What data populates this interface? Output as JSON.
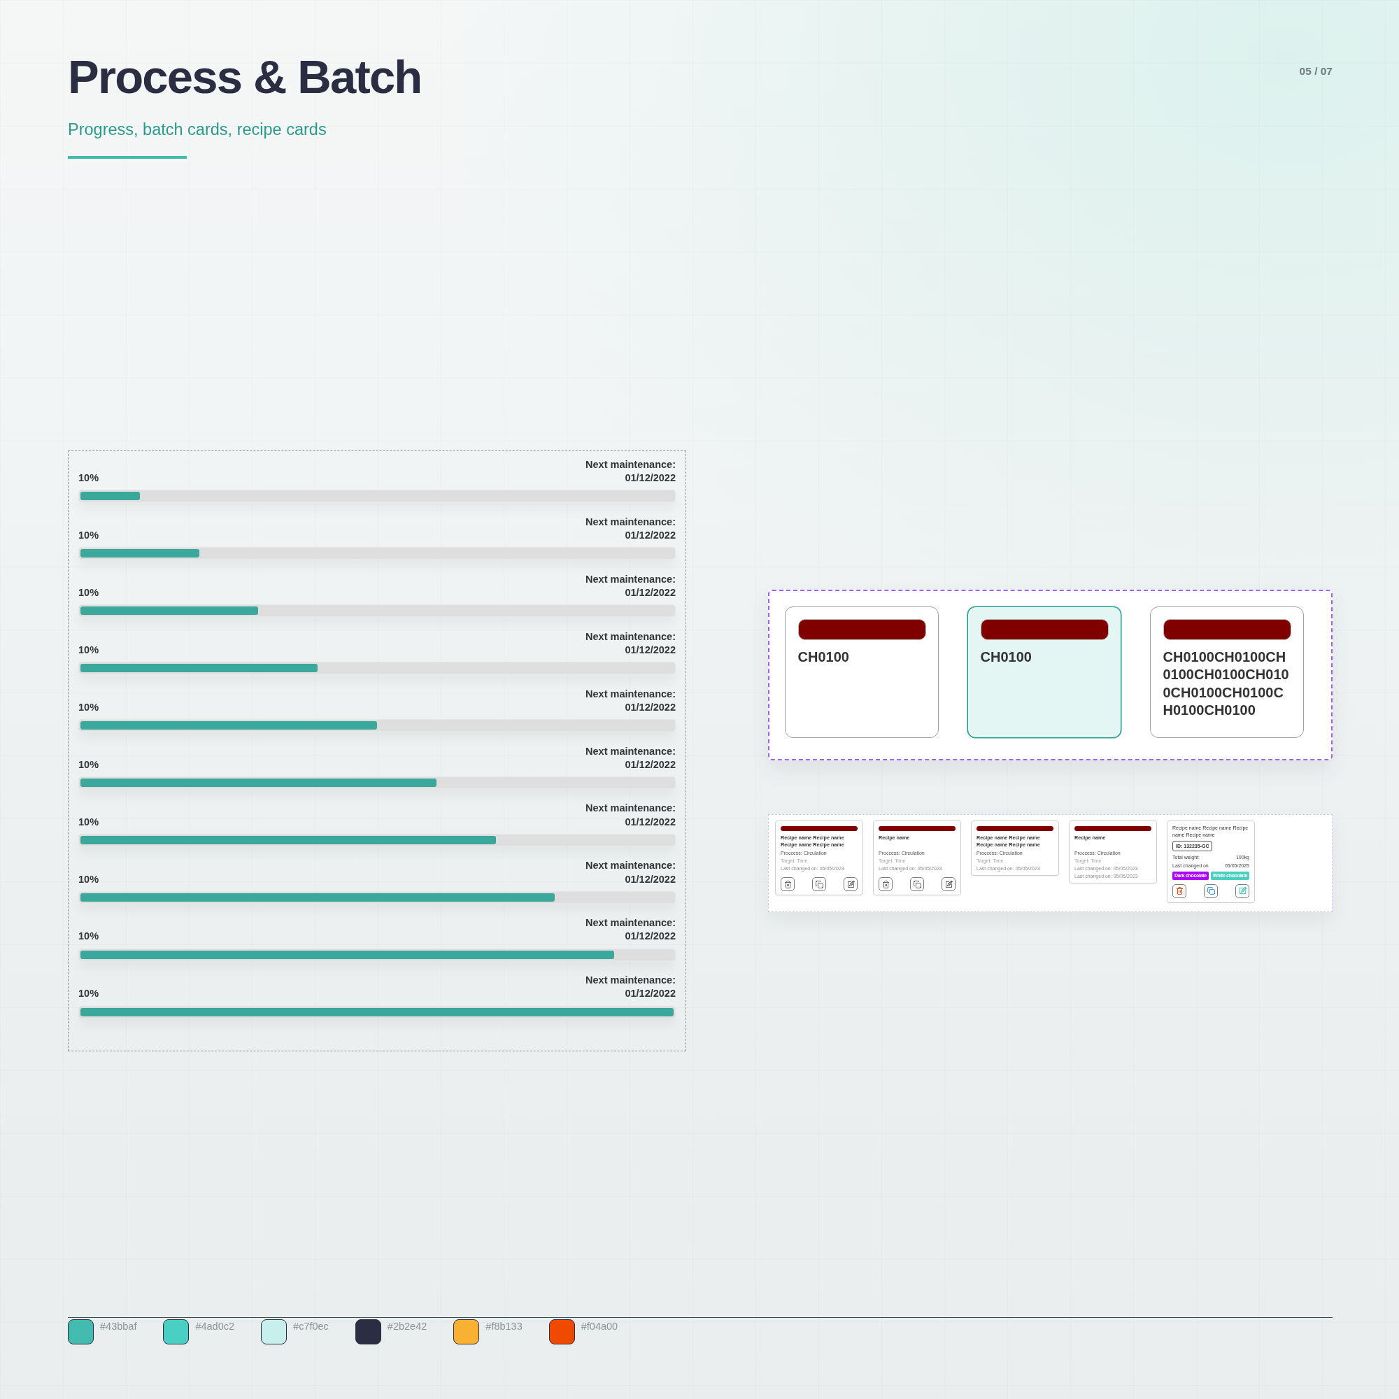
{
  "header": {
    "title": "Process & Batch",
    "subtitle": "Progress, batch cards, recipe cards",
    "page": "05 / 07"
  },
  "progress_rows": [
    {
      "percent": "10%",
      "label": "Next maintenance:",
      "date": "01/12/2022",
      "level": 0.1
    },
    {
      "percent": "10%",
      "label": "Next maintenance:",
      "date": "01/12/2022",
      "level": 0.2
    },
    {
      "percent": "10%",
      "label": "Next maintenance:",
      "date": "01/12/2022",
      "level": 0.3
    },
    {
      "percent": "10%",
      "label": "Next maintenance:",
      "date": "01/12/2022",
      "level": 0.4
    },
    {
      "percent": "10%",
      "label": "Next maintenance:",
      "date": "01/12/2022",
      "level": 0.5
    },
    {
      "percent": "10%",
      "label": "Next maintenance:",
      "date": "01/12/2022",
      "level": 0.6
    },
    {
      "percent": "10%",
      "label": "Next maintenance:",
      "date": "01/12/2022",
      "level": 0.7
    },
    {
      "percent": "10%",
      "label": "Next maintenance:",
      "date": "01/12/2022",
      "level": 0.8
    },
    {
      "percent": "10%",
      "label": "Next maintenance:",
      "date": "01/12/2022",
      "level": 0.9
    },
    {
      "percent": "10%",
      "label": "Next maintenance:",
      "date": "01/12/2022",
      "level": 1.0
    }
  ],
  "batch_cards": [
    {
      "code": "CH0100",
      "selected": false
    },
    {
      "code": "CH0100",
      "selected": true
    },
    {
      "code": "CH0100CH0100CH0100CH0100CH0100CH0100CH0100CH0100CH0100",
      "selected": false
    }
  ],
  "recipe_cards": [
    {
      "kind": "compact",
      "title": "Recipe name Recipe name Recipe name Recipe name",
      "process": "Proccess: Circulation",
      "target": "Target: Time",
      "changes": [
        "Last changed on: 05/05/2023"
      ],
      "actions": [
        {
          "kind": "delete"
        },
        {
          "kind": "copy"
        },
        {
          "kind": "edit"
        }
      ]
    },
    {
      "kind": "compact",
      "title": "Recipe name",
      "process": "Proccess: Circulation",
      "target": "Target: Time",
      "changes": [
        "Last changed on: 05/05/2023"
      ],
      "actions": [
        {
          "kind": "delete"
        },
        {
          "kind": "copy"
        },
        {
          "kind": "edit"
        }
      ]
    },
    {
      "kind": "compact",
      "title": "Recipe name Recipe name Recipe name Recipe name",
      "process": "Proccess: Circulation",
      "target": "Target: Time",
      "changes": [
        "Last changed on: 05/05/2023"
      ]
    },
    {
      "kind": "compact",
      "title": "Recipe name",
      "process": "Proccess: Circulation",
      "target": "Target: Time",
      "changes": [
        "Last changed on: 05/05/2023",
        "Last changed on: 05/05/2023"
      ]
    },
    {
      "kind": "detailed",
      "title": "Recipe name Recipe name Recipe name Recipe name",
      "id": "ID: 132235-GC",
      "facts": [
        {
          "label": "Total weight:",
          "value": "100kg"
        },
        {
          "label": "Last changed on",
          "value": "05/05/2025"
        }
      ],
      "tags": [
        {
          "label": "Dark chocolate",
          "color": "#aa00ff"
        },
        {
          "label": "White chocolate",
          "color": "#4ad0c2"
        }
      ],
      "actions": [
        {
          "kind": "delete",
          "color": "#f04a00"
        },
        {
          "kind": "copy",
          "color": "#3b9de0"
        },
        {
          "kind": "edit",
          "color": "#4ad0c2"
        }
      ]
    }
  ],
  "palette": [
    {
      "color": "#43bbaf",
      "label": "#43bbaf"
    },
    {
      "color": "#4ad0c2",
      "label": "#4ad0c2"
    },
    {
      "color": "#c7f0ec",
      "label": "#c7f0ec"
    },
    {
      "color": "#2b2e42",
      "label": "#2b2e42"
    },
    {
      "color": "#f8b133",
      "label": "#f8b133"
    },
    {
      "color": "#f04a00",
      "label": "#f04a00"
    }
  ]
}
